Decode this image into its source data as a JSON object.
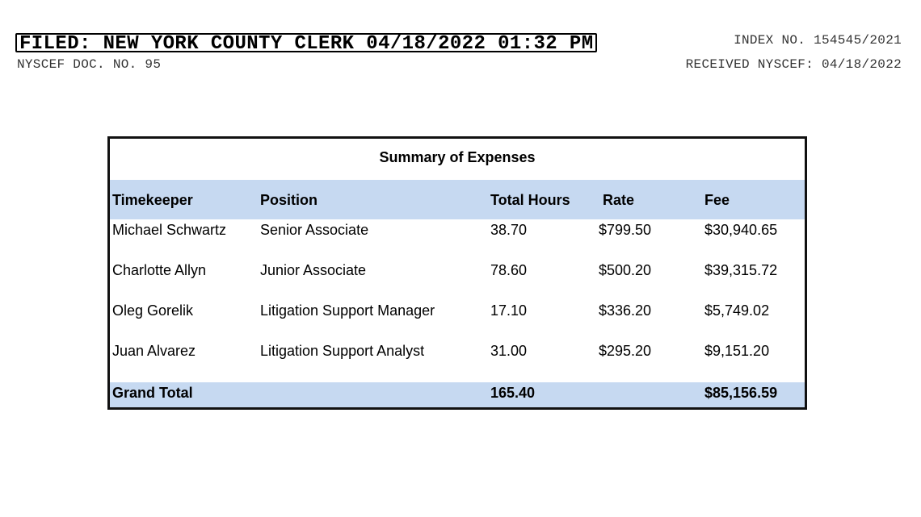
{
  "header": {
    "filed": "FILED: NEW YORK COUNTY CLERK 04/18/2022 01:32 PM",
    "doc_no": "NYSCEF DOC. NO. 95",
    "index_no": "INDEX NO. 154545/2021",
    "received": "RECEIVED NYSCEF: 04/18/2022"
  },
  "table": {
    "title": "Summary of Expenses",
    "columns": [
      "Timekeeper",
      "Position",
      "Total Hours",
      "Rate",
      "Fee"
    ],
    "rows": [
      [
        "Michael Schwartz",
        "Senior Associate",
        "38.70",
        "$799.50",
        "$30,940.65"
      ],
      [
        "Charlotte Allyn",
        "Junior Associate",
        "78.60",
        "$500.20",
        "$39,315.72"
      ],
      [
        "Oleg Gorelik",
        "Litigation Support Manager",
        "17.10",
        "$336.20",
        "$5,749.02"
      ],
      [
        "Juan Alvarez",
        "Litigation Support Analyst",
        "31.00",
        "$295.20",
        "$9,151.20"
      ]
    ],
    "total": {
      "label": "Grand Total",
      "hours": "165.40",
      "fee": "$85,156.59"
    }
  },
  "colors": {
    "band": "#c6d9f1",
    "border": "#111111"
  }
}
